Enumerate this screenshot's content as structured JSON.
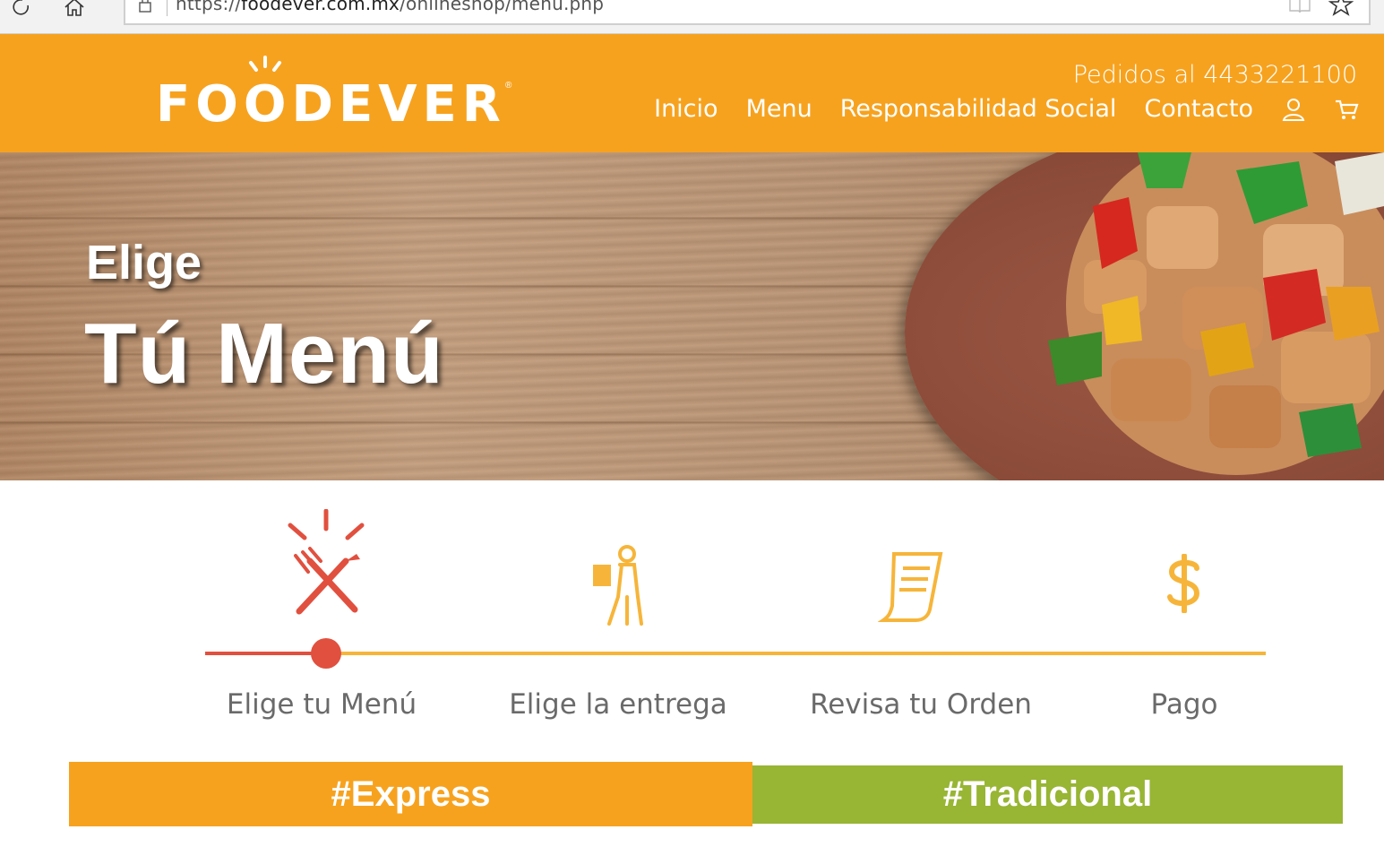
{
  "browser": {
    "url_scheme": "https://",
    "url_host": "foodever.com.mx",
    "url_path": "/onlineshop/menu.php"
  },
  "header": {
    "logo_text": "FOODEVER",
    "phone": "Pedidos al 4433221100",
    "nav": [
      {
        "label": "Inicio"
      },
      {
        "label": "Menu"
      },
      {
        "label": "Responsabilidad Social"
      },
      {
        "label": "Contacto"
      }
    ],
    "icons": [
      "user-icon",
      "cart-icon"
    ]
  },
  "hero": {
    "line1": "Elige",
    "line2": "Tú Menú"
  },
  "steps": {
    "current": 1,
    "items": [
      {
        "label": "Elige tu Menú",
        "icon": "utensils-icon"
      },
      {
        "label": "Elige la entrega",
        "icon": "delivery-person-icon"
      },
      {
        "label": "Revisa tu Orden",
        "icon": "receipt-icon"
      },
      {
        "label": "Pago",
        "icon": "dollar-icon"
      }
    ]
  },
  "tabs": {
    "express": "#Express",
    "tradicional": "#Tradicional"
  },
  "colors": {
    "brand_orange": "#f7a21e",
    "progress_red": "#e1503f",
    "progress_yellow": "#f6b53a",
    "tradicional_green": "#98b534"
  }
}
